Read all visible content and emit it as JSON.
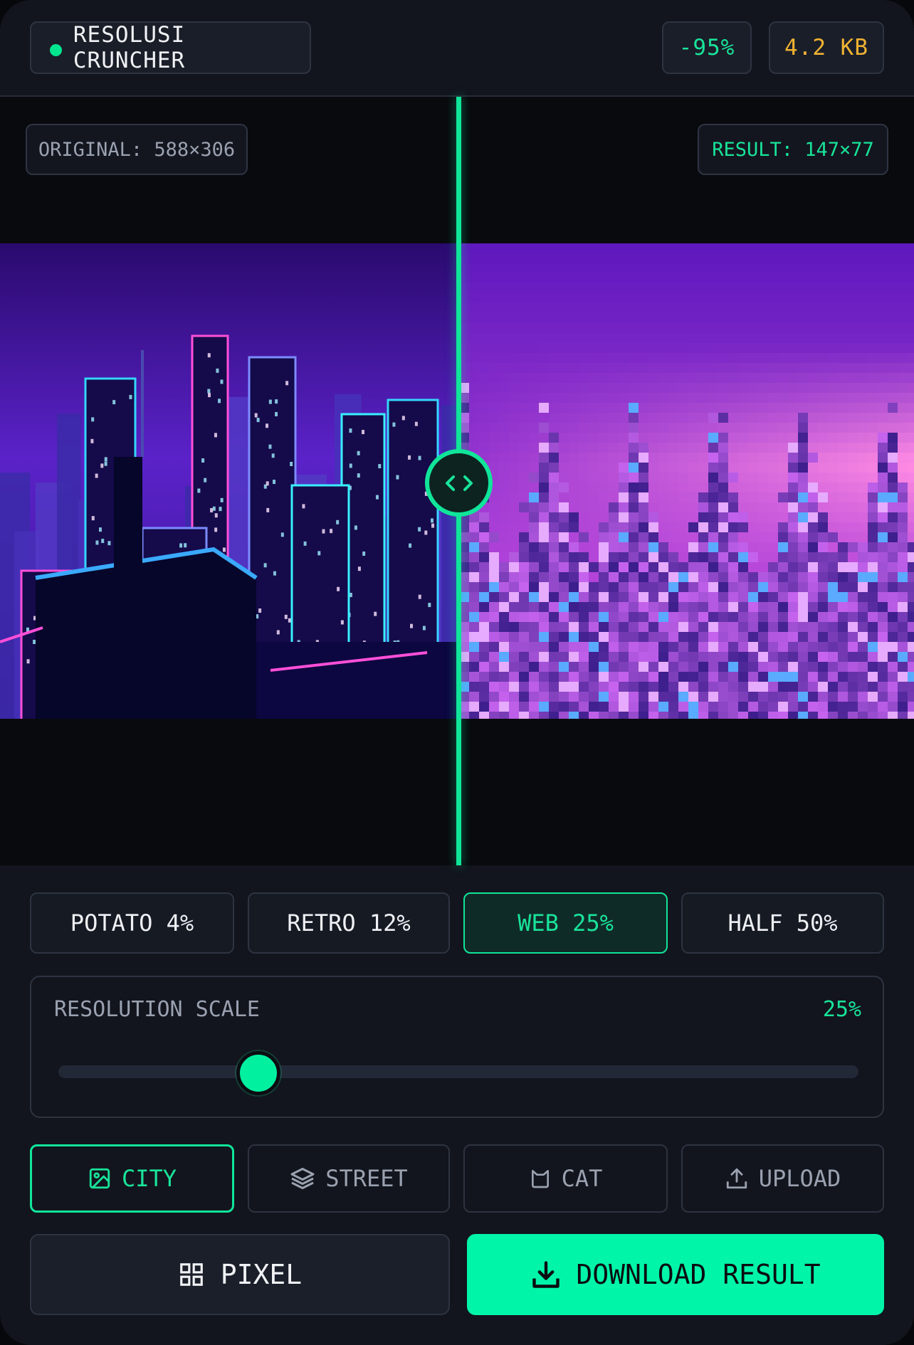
{
  "header": {
    "app_title": "RESOLUSI CRUNCHER",
    "reduction": "-95%",
    "file_size": "4.2 KB"
  },
  "stage": {
    "original_label": "ORIGINAL: 588×306",
    "result_label": "RESULT: 147×77",
    "handle_icon": "code-arrows-icon"
  },
  "presets": [
    {
      "label": "POTATO 4%",
      "active": false
    },
    {
      "label": "RETRO 12%",
      "active": false
    },
    {
      "label": "WEB 25%",
      "active": true
    },
    {
      "label": "HALF 50%",
      "active": false
    }
  ],
  "slider": {
    "label": "RESOLUTION SCALE",
    "value_text": "25%",
    "value_fraction": 0.25
  },
  "sources": [
    {
      "label": "CITY",
      "icon": "image-icon",
      "active": true
    },
    {
      "label": "STREET",
      "icon": "layers-icon",
      "active": false
    },
    {
      "label": "CAT",
      "icon": "cat-icon",
      "active": false
    },
    {
      "label": "UPLOAD",
      "icon": "upload-icon",
      "active": false
    }
  ],
  "actions": {
    "pixel_label": "PIXEL",
    "download_label": "DOWNLOAD RESULT"
  },
  "colors": {
    "accent": "#10e59a",
    "warning": "#f0b232",
    "background": "#12151d"
  }
}
